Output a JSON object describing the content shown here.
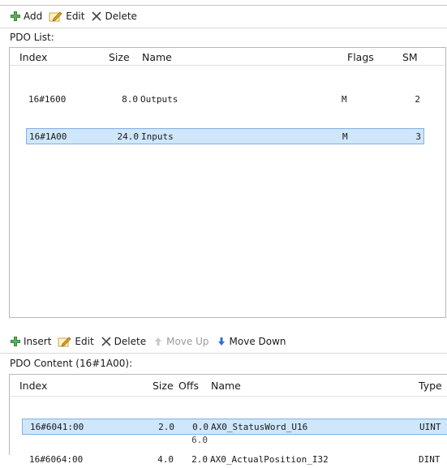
{
  "pdo_toolbar": {
    "add_label": "Add",
    "edit_label": "Edit",
    "delete_label": "Delete"
  },
  "pdo_list": {
    "label": "PDO List:",
    "columns": [
      "Index",
      "Size",
      "Name",
      "Flags",
      "SM"
    ],
    "rows": [
      {
        "index": "16#1600",
        "size": "8.0",
        "name": "Outputs",
        "flags": "M",
        "sm": "2",
        "selected": false
      },
      {
        "index": "16#1A00",
        "size": "24.0",
        "name": "Inputs",
        "flags": "M",
        "sm": "3",
        "selected": true
      }
    ]
  },
  "content_toolbar": {
    "insert_label": "Insert",
    "edit_label": "Edit",
    "delete_label": "Delete",
    "move_up_label": "Move Up",
    "move_down_label": "Move Down"
  },
  "pdo_content": {
    "label": "PDO Content (16#1A00):",
    "columns": [
      "Index",
      "Size",
      "Offs",
      "Name",
      "Type"
    ],
    "rows": [
      {
        "index": "16#6041:00",
        "size": "2.0",
        "offs": "0.0",
        "name": "AX0_StatusWord_U16",
        "type": "UINT",
        "selected": true
      },
      {
        "index": "16#6064:00",
        "size": "4.0",
        "offs": "2.0",
        "name": "AX0_ActualPosition_I32",
        "type": "DINT",
        "selected": false
      }
    ],
    "total_offs": "6.0"
  },
  "colors": {
    "selection_bg": "#cfe6fb",
    "selection_border": "#7fb2e6",
    "plus_icon": "#2e7d32",
    "edit_icon": "#e0a21a",
    "move_down_icon": "#2f6fd6"
  },
  "icons": {
    "add": "plus-icon",
    "edit": "pencil-icon",
    "delete": "x-icon",
    "move_up": "arrow-up-icon",
    "move_down": "arrow-down-icon"
  }
}
